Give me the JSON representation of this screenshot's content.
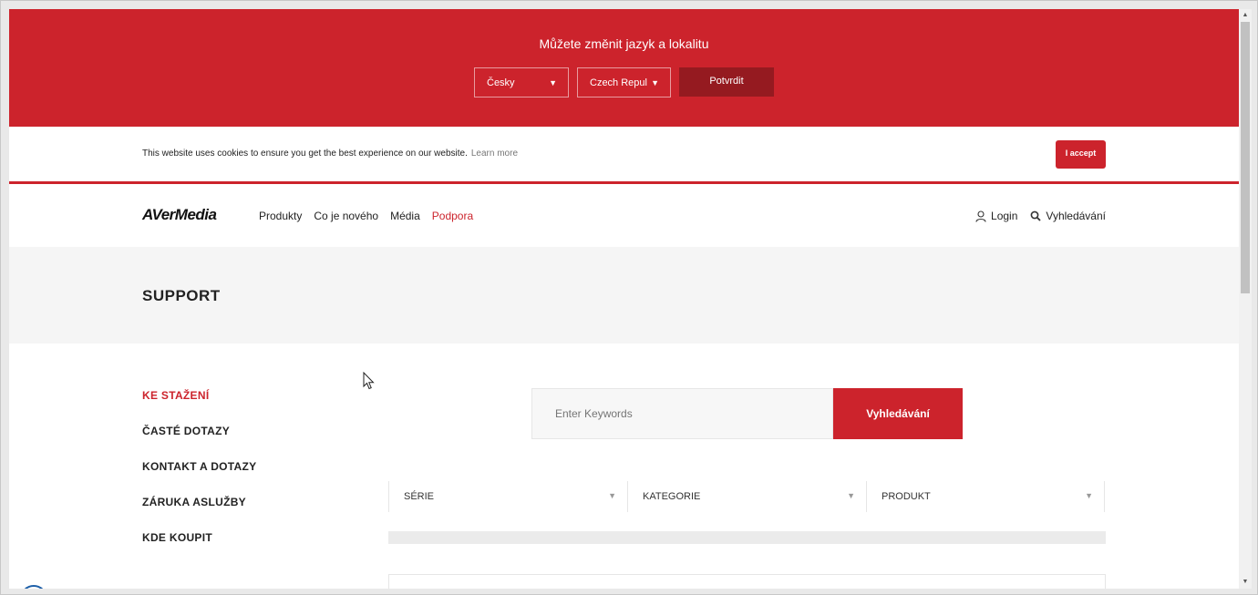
{
  "locale_bar": {
    "title": "Můžete změnit jazyk a lokalitu",
    "language": "Česky",
    "country": "Czech Repul",
    "confirm_label": "Potvrdit"
  },
  "cookie_bar": {
    "text": "This website uses cookies to ensure you get the best experience on our website.",
    "learn_more": "Learn more",
    "accept_label": "I accept"
  },
  "nav": {
    "logo": "AVerMedia",
    "items": [
      "Produkty",
      "Co je nového",
      "Média",
      "Podpora"
    ],
    "login": "Login",
    "search": "Vyhledávání"
  },
  "support": {
    "title": "SUPPORT"
  },
  "sidebar": {
    "items": [
      "KE STAŽENÍ",
      "ČASTÉ DOTAZY",
      "KONTAKT A DOTAZY",
      "ZÁRUKA ASLUŽBY",
      "KDE KOUPIT"
    ]
  },
  "search": {
    "placeholder": "Enter Keywords",
    "button_label": "Vyhledávání"
  },
  "filters": {
    "series": "SÉRIE",
    "category": "KATEGORIE",
    "product": "PRODUKT"
  },
  "colors": {
    "brand_red": "#cc232c",
    "dark_red": "#951a20"
  },
  "icons": {
    "login": "user-icon",
    "search": "search-icon",
    "dropdown": "caret-down-icon"
  }
}
